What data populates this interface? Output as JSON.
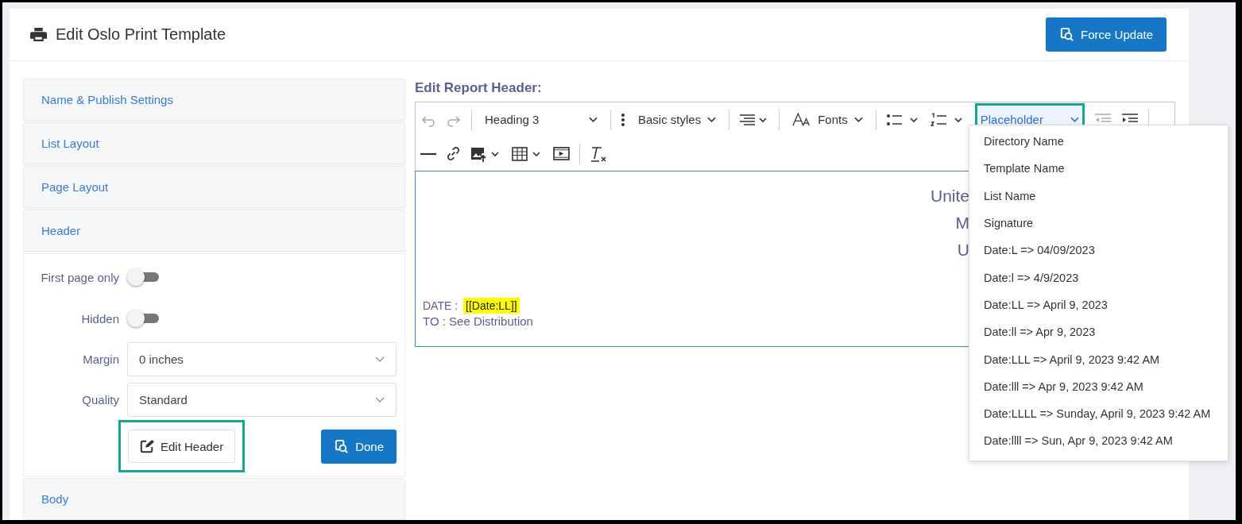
{
  "page": {
    "title": "Edit Oslo Print Template",
    "action_button": "Force Update"
  },
  "sections": [
    {
      "label": "Name & Publish Settings",
      "expanded": false
    },
    {
      "label": "List Layout",
      "expanded": false
    },
    {
      "label": "Page Layout",
      "expanded": false
    },
    {
      "label": "Header",
      "expanded": true
    },
    {
      "label": "Body",
      "expanded": false
    }
  ],
  "header_settings": {
    "toggles": [
      {
        "label": "First page only",
        "on": false
      },
      {
        "label": "Hidden",
        "on": false
      }
    ],
    "selects": [
      {
        "label": "Margin",
        "value": "0 inches"
      },
      {
        "label": "Quality",
        "value": "Standard"
      }
    ],
    "edit_button": {
      "label": "Edit Header",
      "highlighted": true
    },
    "done_button": "Done"
  },
  "editor": {
    "title": "Edit Report Header:",
    "toolbar": {
      "heading": "Heading 3",
      "basic_styles": "Basic styles",
      "fonts": "Fonts",
      "placeholder": {
        "label": "Placeholder",
        "expanded": true,
        "highlighted": true
      }
    },
    "content": {
      "heading_lines": [
        "Unite",
        "M",
        "U"
      ],
      "date_label": "DATE :",
      "date_tag": "[[Date:LL]]",
      "to_line": "TO : See Distribution"
    },
    "placeholder_options": [
      "Directory Name",
      "Template Name",
      "List Name",
      "Signature",
      "Date:L => 04/09/2023",
      "Date:l => 4/9/2023",
      "Date:LL => April 9, 2023",
      "Date:ll => Apr 9, 2023",
      "Date:LLL => April 9, 2023 9:42 AM",
      "Date:lll => Apr 9, 2023 9:42 AM",
      "Date:LLLL => Sunday, April 9, 2023 9:42 AM",
      "Date:llll => Sun, Apr 9, 2023 9:42 AM"
    ]
  }
}
